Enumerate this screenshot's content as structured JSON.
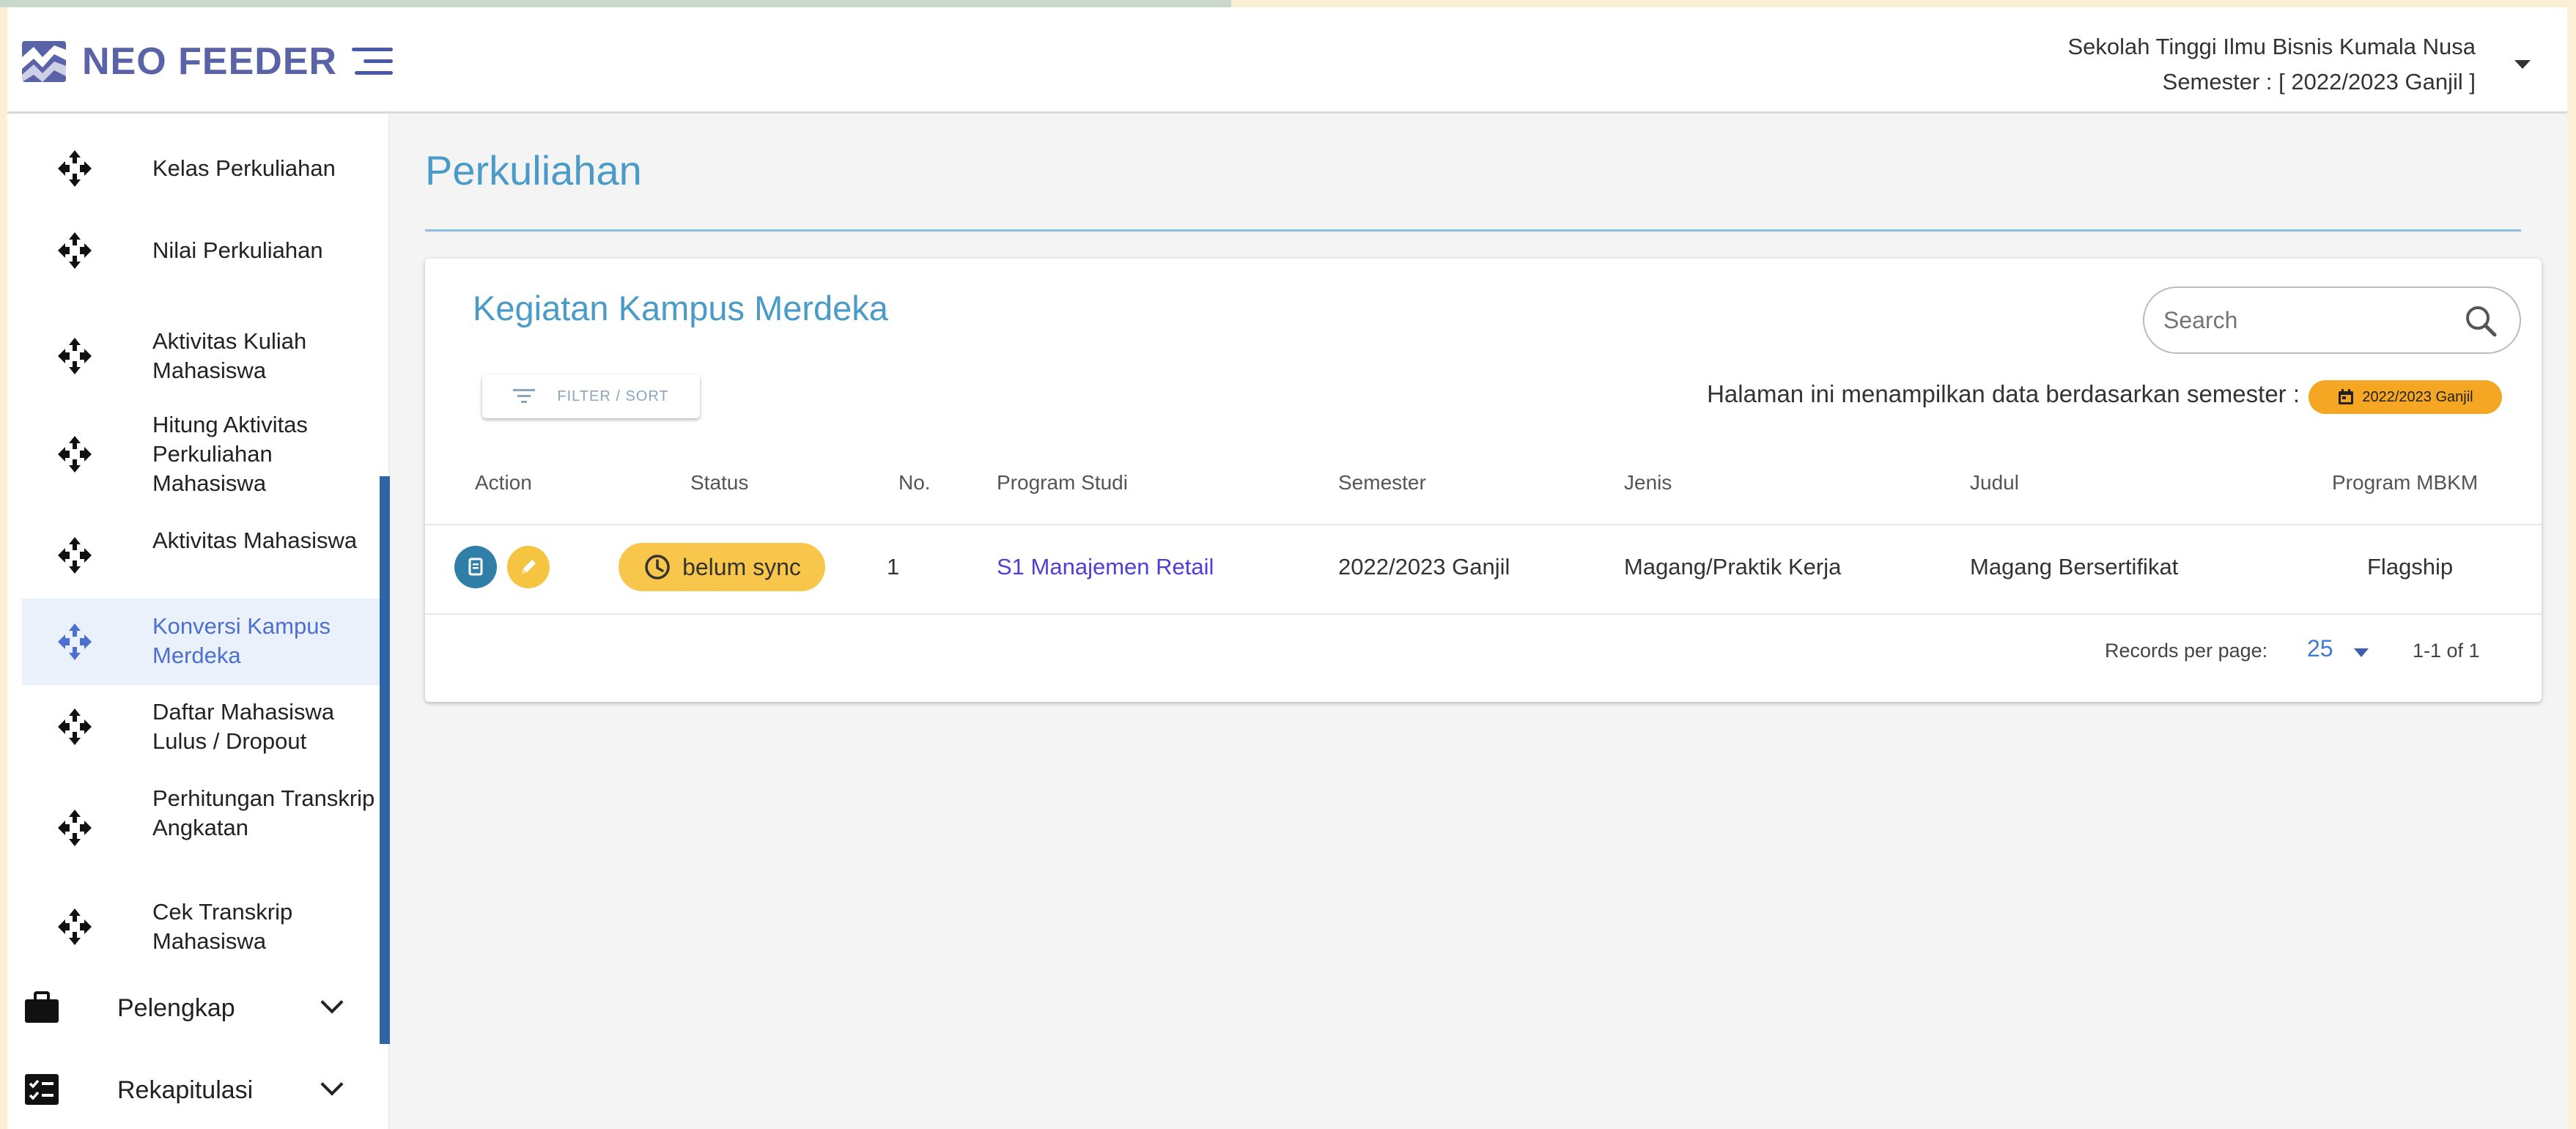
{
  "app": {
    "logo_text": "NEO FEEDER",
    "institution": "Sekolah Tinggi Ilmu Bisnis Kumala Nusa",
    "semester_header": "Semester : [ 2022/2023 Ganjil ]"
  },
  "sidebar": {
    "items": [
      {
        "label": "Kelas Perkuliahan"
      },
      {
        "label": "Nilai Perkuliahan"
      },
      {
        "label": "Aktivitas Kuliah Mahasiswa"
      },
      {
        "label": "Hitung Aktivitas Perkuliahan Mahasiswa"
      },
      {
        "label": "Aktivitas Mahasiswa"
      },
      {
        "label": "Konversi Kampus Merdeka",
        "active": true
      },
      {
        "label": "Daftar Mahasiswa Lulus / Dropout"
      },
      {
        "label": "Perhitungan Transkrip Angkatan"
      },
      {
        "label": "Cek Transkrip Mahasiswa"
      }
    ],
    "groups": [
      {
        "label": "Pelengkap"
      },
      {
        "label": "Rekapitulasi"
      }
    ]
  },
  "main": {
    "page_title": "Perkuliahan",
    "card_title": "Kegiatan Kampus Merdeka",
    "search_placeholder": "Search",
    "filter_label": "FILTER / SORT",
    "semester_note": "Halaman ini menampilkan data berdasarkan semester :",
    "semester_badge": "2022/2023 Ganjil",
    "columns": [
      "Action",
      "Status",
      "No.",
      "Program Studi",
      "Semester",
      "Jenis",
      "Judul",
      "Program MBKM"
    ],
    "rows": [
      {
        "status": "belum sync",
        "no": "1",
        "program_studi": "S1 Manajemen Retail",
        "semester": "2022/2023 Ganjil",
        "jenis": "Magang/Praktik Kerja",
        "judul": "Magang Bersertifikat",
        "program_mbkm": "Flagship"
      }
    ],
    "pager": {
      "records_label": "Records per page:",
      "per_page": "25",
      "range": "1-1 of 1"
    }
  },
  "colors": {
    "brand": "#5a63a8",
    "accent": "#4a9bc7",
    "status_chip": "#f7c64a",
    "semester_badge": "#f5a623"
  }
}
